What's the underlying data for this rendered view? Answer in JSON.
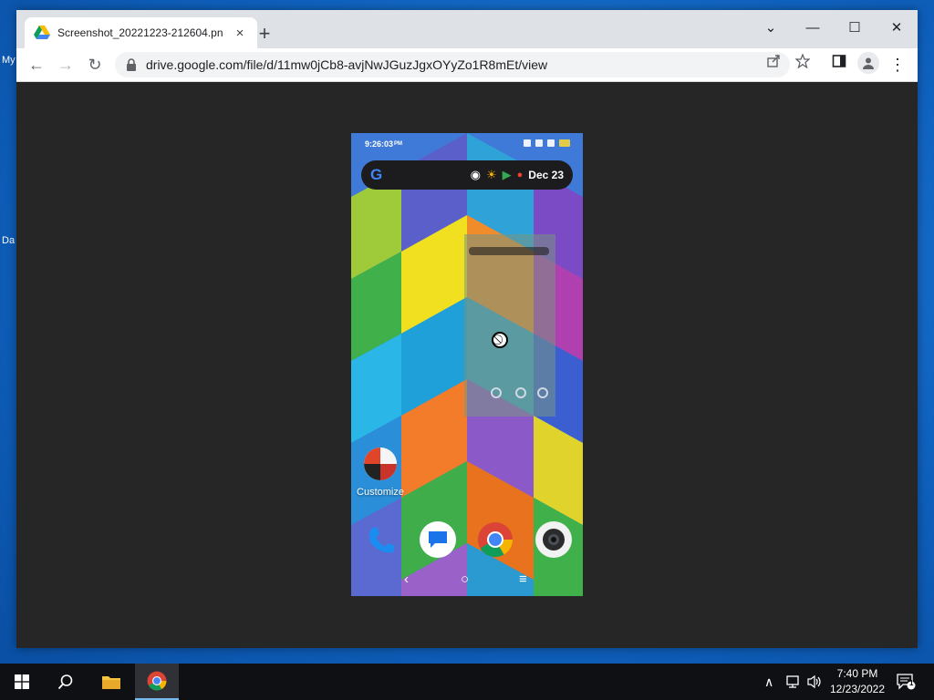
{
  "desktop": {
    "icon_label_1": "My",
    "icon_label_2": "Da"
  },
  "browser": {
    "tab": {
      "title": "Screenshot_20221223-212604.pn",
      "close_label": "×"
    },
    "new_tab_label": "+",
    "window_controls": {
      "minimize": "—",
      "maximize": "☐",
      "close": "✕",
      "tab_search": "⌄"
    },
    "toolbar": {
      "back": "←",
      "forward": "→",
      "reload": "↻",
      "url": "drive.google.com/file/d/11mw0jCb8-avjNwJGuzJgxOYyZo1R8mEt/view",
      "share_icon": "share-icon",
      "bookmark_icon": "star-icon",
      "side_panel_icon": "side-panel-icon",
      "menu": "⋮"
    }
  },
  "phone": {
    "status_time": "9:26:03",
    "status_time_suffix": "PM",
    "search_widget": {
      "date": "Dec 23",
      "g_logo": "G"
    },
    "customize_label": "Customize",
    "dock_apps": [
      "phone-app",
      "messages-app",
      "chrome-app",
      "camera-app"
    ],
    "nav": {
      "back": "‹",
      "home": "○",
      "recents": "≡"
    }
  },
  "taskbar": {
    "clock_time": "7:40 PM",
    "clock_date": "12/23/2022",
    "notification_count": "1",
    "pinned": [
      "start-button",
      "search-button",
      "file-explorer",
      "chrome"
    ]
  },
  "colors": {
    "titlebar": "#dee1e6",
    "viewer_bg": "#262626",
    "taskbar": "#0f1014",
    "desktop": "#1473c9"
  }
}
